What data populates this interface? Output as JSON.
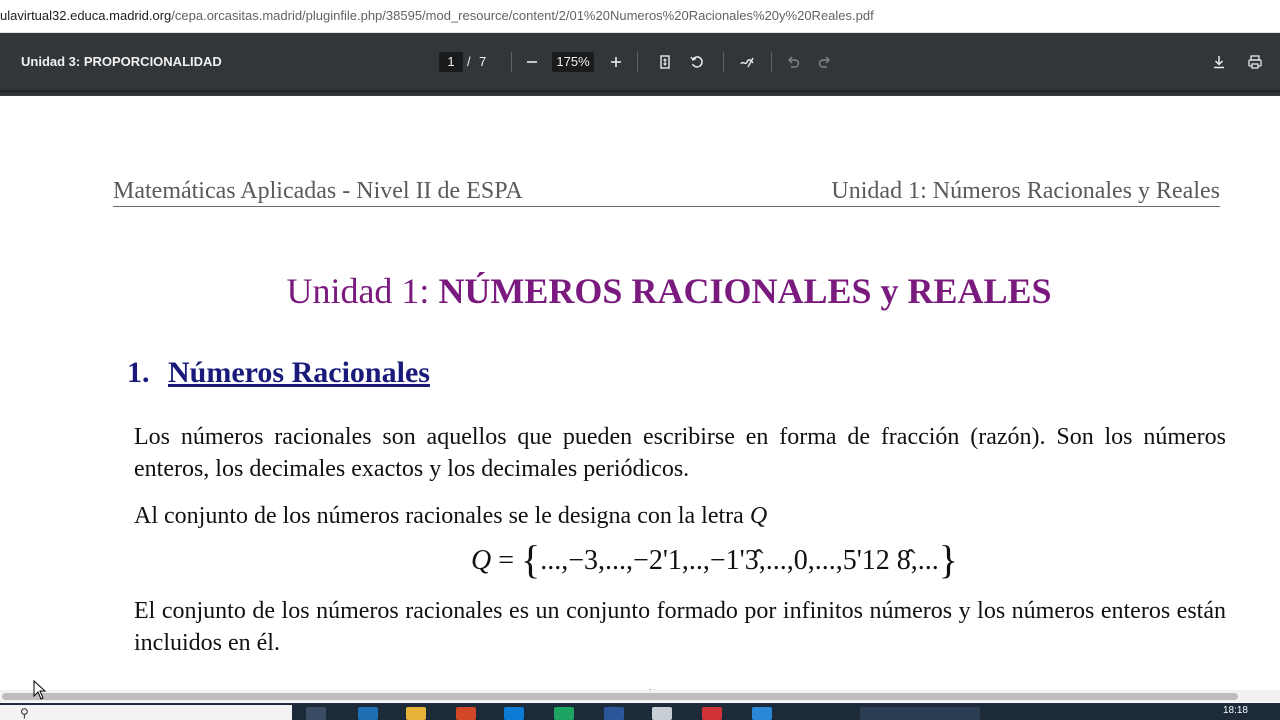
{
  "browser": {
    "url_host": "ulavirtual32.educa.madrid.org",
    "url_path": "/cepa.orcasitas.madrid/pluginfile.php/38595/mod_resource/content/2/01%20Numeros%20Racionales%20y%20Reales.pdf"
  },
  "pdf_toolbar": {
    "title": "Unidad 3: PROPORCIONALIDAD",
    "current_page": "1",
    "page_separator": "/",
    "total_pages": "7",
    "zoom": "175%"
  },
  "document": {
    "header_left": "Matemáticas Aplicadas - Nivel II de ESPA",
    "header_right": "Unidad 1: Números Racionales y Reales",
    "title_prefix": "Unidad 1: ",
    "title_main": "NÚMEROS RACIONALES y REALES",
    "section_number": "1.",
    "section_title": "Números Racionales",
    "paragraph_1": "Los números racionales son aquellos que pueden escribirse en forma de fracción (razón). Son los números enteros, los decimales exactos y los decimales periódicos.",
    "paragraph_2_text": "Al conjunto de los números racionales se le designa con la letra ",
    "paragraph_2_letter": "Q",
    "formula_lhs": "Q",
    "formula_eq": " = ",
    "formula_open": "{",
    "formula_body": "...,−3,...,−2'1,..,−1'3̂,...,0,...,5'12 8̂,...",
    "formula_close": "}",
    "paragraph_3": "El conjunto de los números racionales es un conjunto formado por infinitos números y los números enteros están incluidos en él.",
    "next_line_fragment": "~"
  },
  "taskbar": {
    "clock": "18:18"
  }
}
